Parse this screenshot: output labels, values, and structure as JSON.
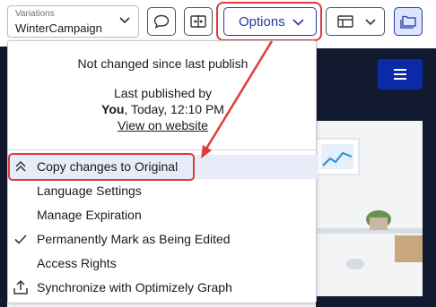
{
  "toolbar": {
    "variations_caption": "Variations",
    "variations_value": "WinterCampaign",
    "options_label": "Options"
  },
  "menu": {
    "status": "Not changed since last publish",
    "published_label": "Last published by",
    "published_user": "You",
    "published_time": ", Today, 12:10 PM",
    "view_link": "View on website",
    "items": [
      {
        "label": "Copy changes to Original",
        "icon": "double-chevron-up-icon"
      },
      {
        "label": "Language Settings",
        "icon": ""
      },
      {
        "label": "Manage Expiration",
        "icon": ""
      },
      {
        "label": "Permanently Mark as Being Edited",
        "icon": "checkmark-icon"
      },
      {
        "label": "Access Rights",
        "icon": ""
      },
      {
        "label": "Synchronize with Optimizely Graph",
        "icon": "upload-icon"
      }
    ]
  },
  "colors": {
    "accent": "#2b3a9c",
    "highlight": "#e03a3a",
    "selected_row": "#e8ecf9",
    "page_dark": "#121a2f",
    "hamburger": "#0b2aa8"
  }
}
